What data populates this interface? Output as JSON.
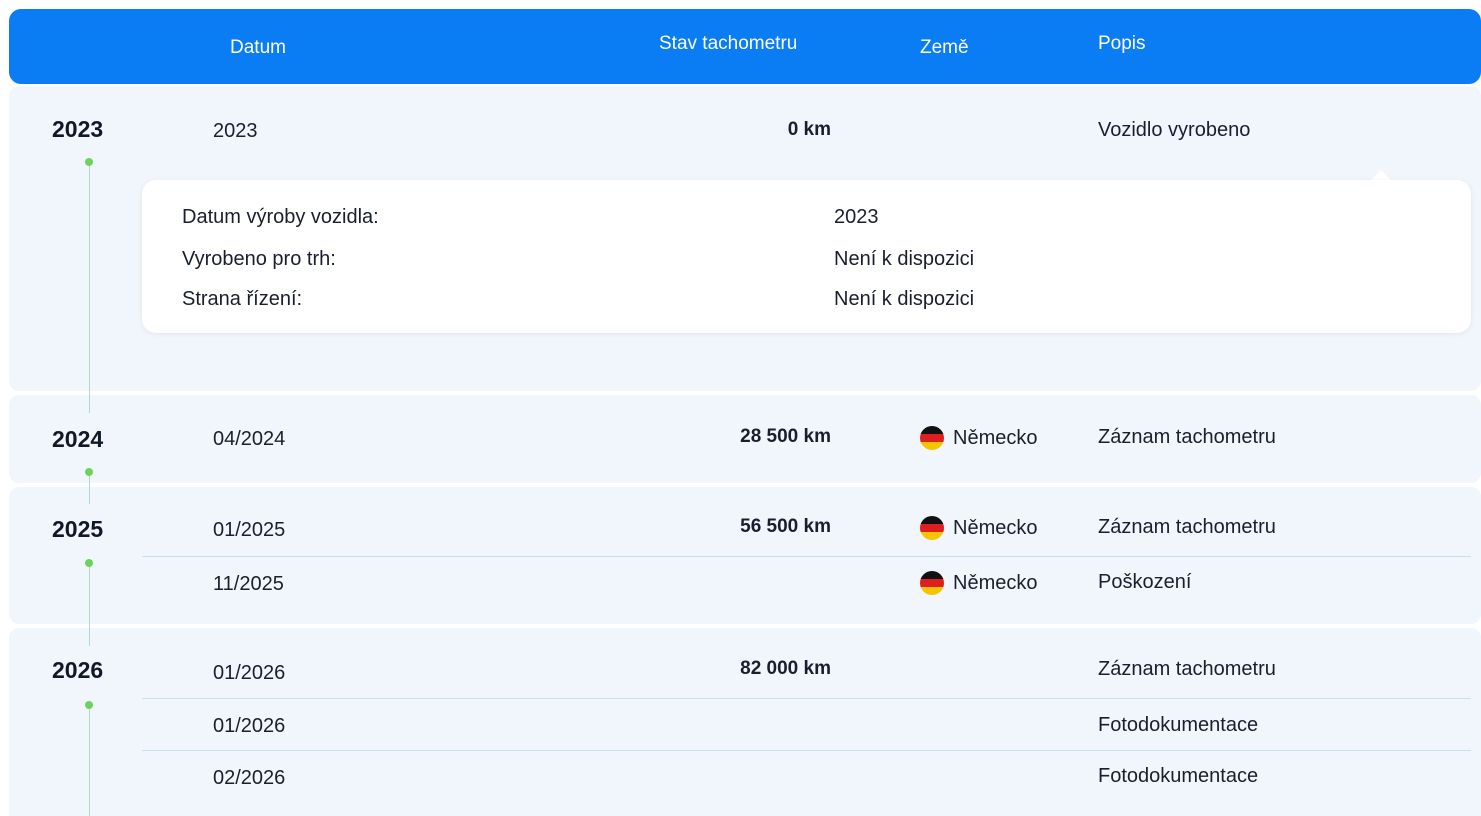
{
  "header": {
    "date_label": "Datum",
    "odometer_label": "Stav tachometru",
    "country_label": "Země",
    "description_label": "Popis"
  },
  "colors": {
    "header_bg": "#0a7cf4",
    "row_bg": "#f0f6fb",
    "timeline_dot": "#6dd35a"
  },
  "years": [
    {
      "year": "2023",
      "entries": [
        {
          "date": "2023",
          "km": "0 km",
          "country": "",
          "flag_icon": "",
          "description": "Vozidlo vyrobeno"
        }
      ],
      "details": [
        {
          "label": "Datum výroby vozidla:",
          "value": "2023"
        },
        {
          "label": "Vyrobeno pro trh:",
          "value": "Není k dispozici"
        },
        {
          "label": "Strana řízení:",
          "value": "Není k dispozici"
        }
      ]
    },
    {
      "year": "2024",
      "entries": [
        {
          "date": "04/2024",
          "km": "28 500 km",
          "country": "Německo",
          "flag_icon": "germany-flag-icon",
          "description": "Záznam tachometru"
        }
      ]
    },
    {
      "year": "2025",
      "entries": [
        {
          "date": "01/2025",
          "km": "56 500 km",
          "country": "Německo",
          "flag_icon": "germany-flag-icon",
          "description": "Záznam tachometru"
        },
        {
          "date": "11/2025",
          "km": "",
          "country": "Německo",
          "flag_icon": "germany-flag-icon",
          "description": "Poškození"
        }
      ]
    },
    {
      "year": "2026",
      "entries": [
        {
          "date": "01/2026",
          "km": "82 000 km",
          "country": "",
          "flag_icon": "",
          "description": "Záznam tachometru"
        },
        {
          "date": "01/2026",
          "km": "",
          "country": "",
          "flag_icon": "",
          "description": "Fotodokumentace"
        },
        {
          "date": "02/2026",
          "km": "",
          "country": "",
          "flag_icon": "",
          "description": "Fotodokumentace"
        }
      ]
    }
  ]
}
